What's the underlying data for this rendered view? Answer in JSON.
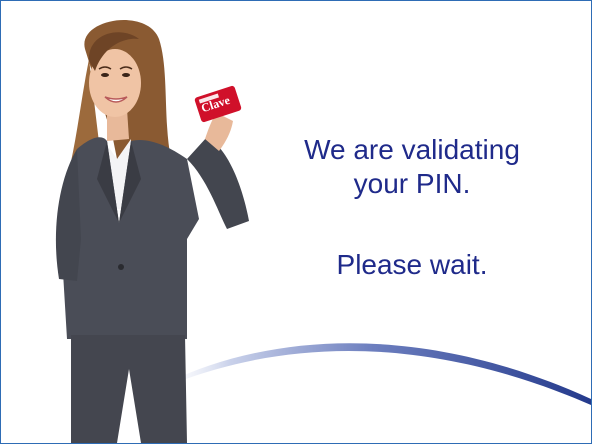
{
  "screen": {
    "message_line1": "We are validating",
    "message_line2": "your PIN.",
    "wait_text": "Please wait.",
    "card_brand": "Clave",
    "card_small_text": "TARJETA"
  },
  "colors": {
    "text": "#1f2a8a",
    "frame": "#2e6cb5",
    "swoosh": "#243a8c",
    "card": "#d0102a",
    "suit": "#4a4d57"
  },
  "icons": {
    "illustration": "woman-holding-card"
  }
}
